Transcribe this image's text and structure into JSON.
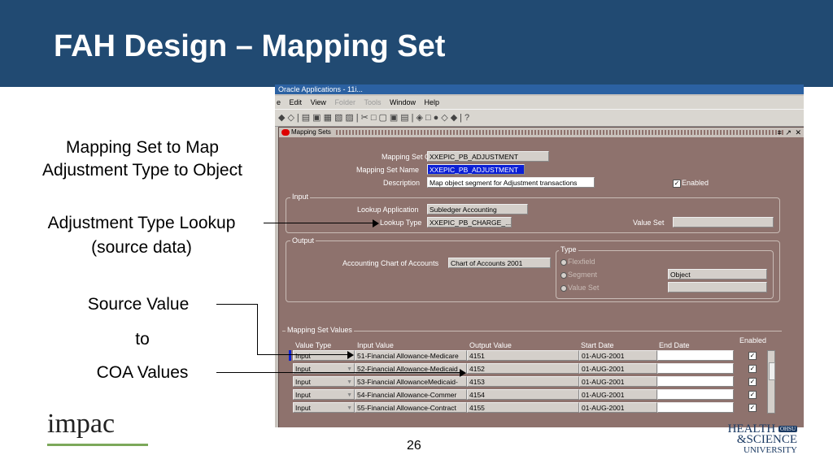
{
  "slide": {
    "title": "FAH Design – Mapping Set",
    "page_number": "26",
    "captions": {
      "c1_l1": "Mapping Set to Map",
      "c1_l2": "Adjustment Type to Object",
      "c2_l1": "Adjustment Type Lookup",
      "c2_l2": "(source data)",
      "c3_l1": "Source Value",
      "c3_l2": "to",
      "c3_l3": "COA Values"
    },
    "logos": {
      "impac": "impac",
      "ohsu_1": "HEALTH",
      "ohsu_badge": "OHSU",
      "ohsu_2": "&SCIENCE",
      "ohsu_3": "UNIVERSITY"
    }
  },
  "app": {
    "titlebar": "Oracle Applications - 11i...",
    "menu": [
      "e",
      "Edit",
      "View",
      "Folder",
      "Tools",
      "Window",
      "Help"
    ],
    "toolbar_glyphs": "◆◇|▤▣▦▧▨|✂□▢▣▤|◈□●◇◆|?",
    "window": {
      "title": "Mapping Sets",
      "controls": "≡ ↗ ✕",
      "header": {
        "code_label": "Mapping Set Code",
        "code_value": "XXEPIC_PB_ADJUSTMENT",
        "name_label": "Mapping Set Name",
        "name_value": "XXEPIC_PB_ADJUSTMENT",
        "desc_label": "Description",
        "desc_value": "Map object segment for Adjustment transactions",
        "enabled_label": "Enabled",
        "enabled": true
      },
      "input_group": {
        "title": "Input",
        "lookup_app_label": "Lookup Application",
        "lookup_app_value": "Subledger Accounting",
        "lookup_type_label": "Lookup Type",
        "lookup_type_value": "XXEPIC_PB_CHARGE_...",
        "value_set_label": "Value Set",
        "value_set_value": ""
      },
      "output_group": {
        "title": "Output",
        "coa_label": "Accounting Chart of Accounts",
        "coa_value": "Chart of Accounts 2001",
        "type_title": "Type",
        "types": [
          "Flexfield",
          "Segment",
          "Value Set"
        ],
        "segment_value": "Object",
        "value_set_value": ""
      },
      "values": {
        "title": "Mapping Set Values",
        "columns": [
          "Value Type",
          "Input Value",
          "Output Value",
          "Start Date",
          "End Date",
          "Enabled"
        ],
        "rows": [
          {
            "type": "Input",
            "input": "51-Financial Allowance-Medicare",
            "output": "4151",
            "start": "01-AUG-2001",
            "end": "",
            "enabled": true
          },
          {
            "type": "Input",
            "input": "52-Financial Allowance-Medicaid",
            "output": "4152",
            "start": "01-AUG-2001",
            "end": "",
            "enabled": true
          },
          {
            "type": "Input",
            "input": "53-Financial AllowanceMedicaid-",
            "output": "4153",
            "start": "01-AUG-2001",
            "end": "",
            "enabled": true
          },
          {
            "type": "Input",
            "input": "54-Financial Allowance-Commer",
            "output": "4154",
            "start": "01-AUG-2001",
            "end": "",
            "enabled": true
          },
          {
            "type": "Input",
            "input": "55-Financial Allowance-Contract",
            "output": "4155",
            "start": "01-AUG-2001",
            "end": "",
            "enabled": true
          }
        ]
      }
    }
  }
}
